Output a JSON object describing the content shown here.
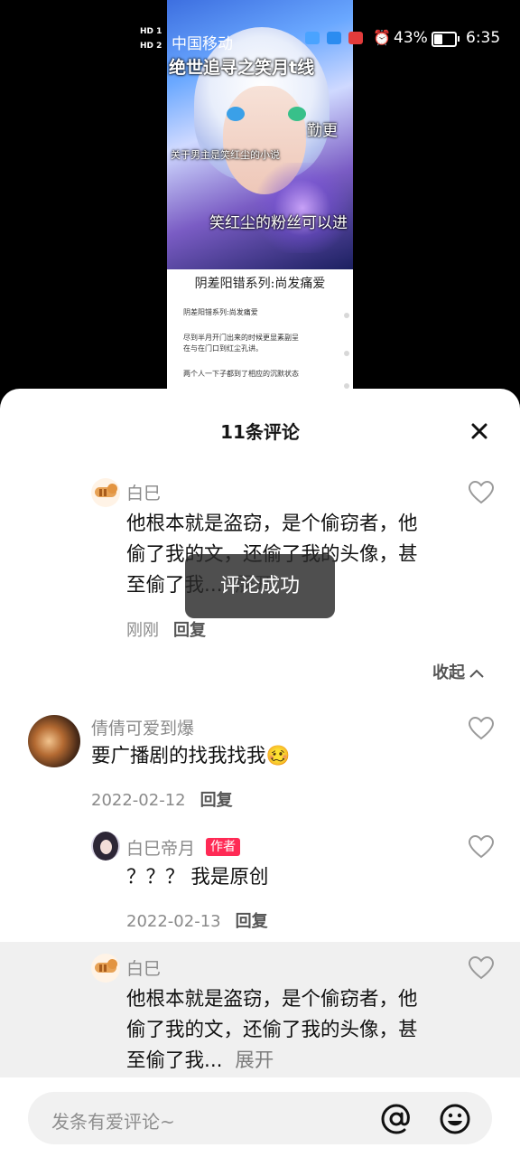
{
  "status_bar": {
    "hd1": "HD 1",
    "hd2": "HD 2",
    "carrier": "中国移动",
    "battery_pct": "43%",
    "battery_level": 0.43,
    "time": "6:35",
    "icons": [
      "weather-icon",
      "cloud-icon",
      "notification-icon",
      "alarm-icon",
      "battery-icon"
    ]
  },
  "video": {
    "overlay_lines": [
      "绝世追寻之笑月t线",
      "勤更",
      "关于男主是笑红尘的小说",
      "笑红尘的粉丝可以进"
    ],
    "doc_title": "阴差阳错系列:尚发痛爱",
    "doc_lines": [
      "阴差阳错系列:尚发痛爱",
      "尽到半月开门出来的时候更显素副呈",
      "在与在门口到红尘孔讲。",
      "两个人一下子都到了相应的沉默状态"
    ]
  },
  "sheet": {
    "title": "11条评论",
    "collapse_label": "收起",
    "toast": "评论成功",
    "input_placeholder": "发条有爱评论~"
  },
  "comments": [
    {
      "name": "白巳",
      "text": "他根本就是盗窃，是个偷窃者，他偷了我的文，还偷了我的头像，甚至偷了我...",
      "more": "展开",
      "date": "刚刚",
      "reply": "回复"
    },
    {
      "name": "倩倩可爱到爆",
      "text": "要广播剧的找我找我🥴",
      "date": "2022-02-12",
      "reply": "回复"
    },
    {
      "name": "白巳帝月",
      "badge": "作者",
      "text": "？？？ 我是原创",
      "date": "2022-02-13",
      "reply": "回复"
    },
    {
      "name": "白巳",
      "text": "他根本就是盗窃，是个偷窃者，他偷了我的文，还偷了我的头像，甚至偷了我...",
      "more": "展开"
    }
  ],
  "colors": {
    "badge": "#ff2a55",
    "sheet_bg": "#ffffff",
    "highlight_bg": "#f0f0f0"
  }
}
